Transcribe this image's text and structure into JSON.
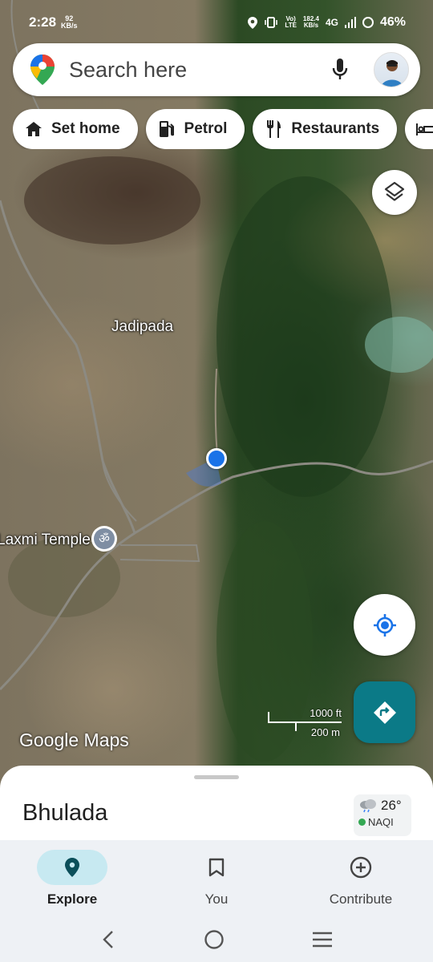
{
  "status_bar": {
    "time": "2:28",
    "net_speed_top": "92",
    "net_speed_unit": "KB/s",
    "volte_top": "Vo)",
    "volte_bottom": "LTE",
    "data_rate_top": "182.4",
    "data_rate_unit": "KB/s",
    "network": "4G",
    "battery": "46%"
  },
  "search": {
    "placeholder": "Search here"
  },
  "chips": [
    {
      "label": "Set home",
      "icon": "home-icon"
    },
    {
      "label": "Petrol",
      "icon": "fuel-pump-icon"
    },
    {
      "label": "Restaurants",
      "icon": "fork-knife-icon"
    },
    {
      "label": "",
      "icon": "bed-icon"
    }
  ],
  "map": {
    "place_label": "Jadipada",
    "poi_label": "Laxmi Temple",
    "poi_icon": "om-symbol-icon",
    "logo": "Google Maps",
    "scale_imperial": "1000 ft",
    "scale_metric": "200 m"
  },
  "sheet": {
    "area_name": "Bhulada",
    "temperature": "26°",
    "aqi": "NAQI",
    "weather_icon": "cloud-rain-icon"
  },
  "bottom_nav": [
    {
      "label": "Explore",
      "icon": "pin-icon",
      "active": true
    },
    {
      "label": "You",
      "icon": "bookmark-icon",
      "active": false
    },
    {
      "label": "Contribute",
      "icon": "add-circle-icon",
      "active": false
    }
  ],
  "colors": {
    "accent": "#0b7a87",
    "location_dot": "#1a73e8",
    "active_pill": "#c7e9f1"
  }
}
